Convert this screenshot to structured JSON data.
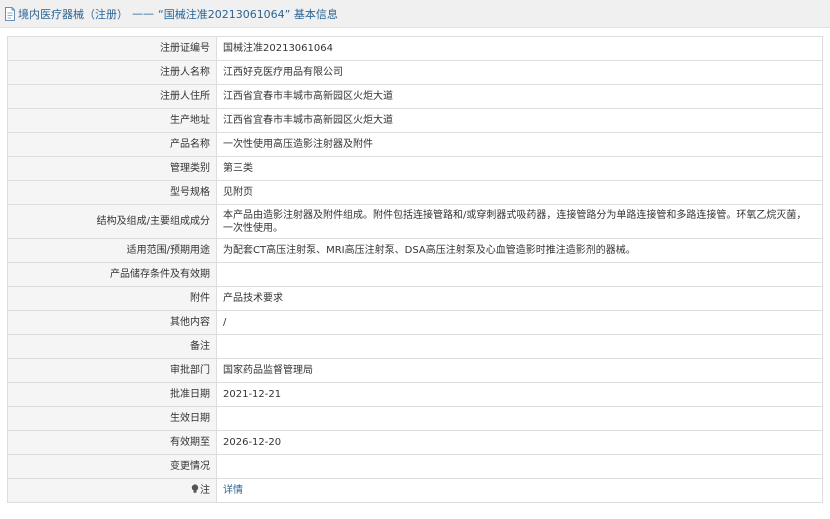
{
  "header": {
    "category": "境内医疗器械（注册）",
    "separator": "——",
    "subject": "“国械注准20213061064” 基本信息"
  },
  "rows": [
    {
      "label": "注册证编号",
      "value": "国械注准20213061064"
    },
    {
      "label": "注册人名称",
      "value": "江西好克医疗用品有限公司"
    },
    {
      "label": "注册人住所",
      "value": "江西省宜春市丰城市高新园区火炬大道"
    },
    {
      "label": "生产地址",
      "value": "江西省宜春市丰城市高新园区火炬大道"
    },
    {
      "label": "产品名称",
      "value": "一次性使用高压造影注射器及附件"
    },
    {
      "label": "管理类别",
      "value": "第三类"
    },
    {
      "label": "型号规格",
      "value": "见附页"
    },
    {
      "label": "结构及组成/主要组成成分",
      "value": "本产品由造影注射器及附件组成。附件包括连接管路和/或穿刺器式吸药器，连接管路分为单路连接管和多路连接管。环氧乙烷灭菌，一次性使用。"
    },
    {
      "label": "适用范围/预期用途",
      "value": "为配套CT高压注射泵、MRI高压注射泵、DSA高压注射泵及心血管造影时推注造影剂的器械。"
    },
    {
      "label": "产品储存条件及有效期",
      "value": ""
    },
    {
      "label": "附件",
      "value": "产品技术要求"
    },
    {
      "label": "其他内容",
      "value": "/"
    },
    {
      "label": "备注",
      "value": ""
    },
    {
      "label": "审批部门",
      "value": "国家药品监督管理局"
    },
    {
      "label": "批准日期",
      "value": "2021-12-21"
    },
    {
      "label": "生效日期",
      "value": ""
    },
    {
      "label": "有效期至",
      "value": "2026-12-20"
    },
    {
      "label": "变更情况",
      "value": ""
    }
  ],
  "footer": {
    "label": "注",
    "link": "详情"
  },
  "colors": {
    "link": "#2a6496",
    "label_bg": "#f5f5f5",
    "border": "#dddddd",
    "header_bg": "#f0f0f0"
  }
}
